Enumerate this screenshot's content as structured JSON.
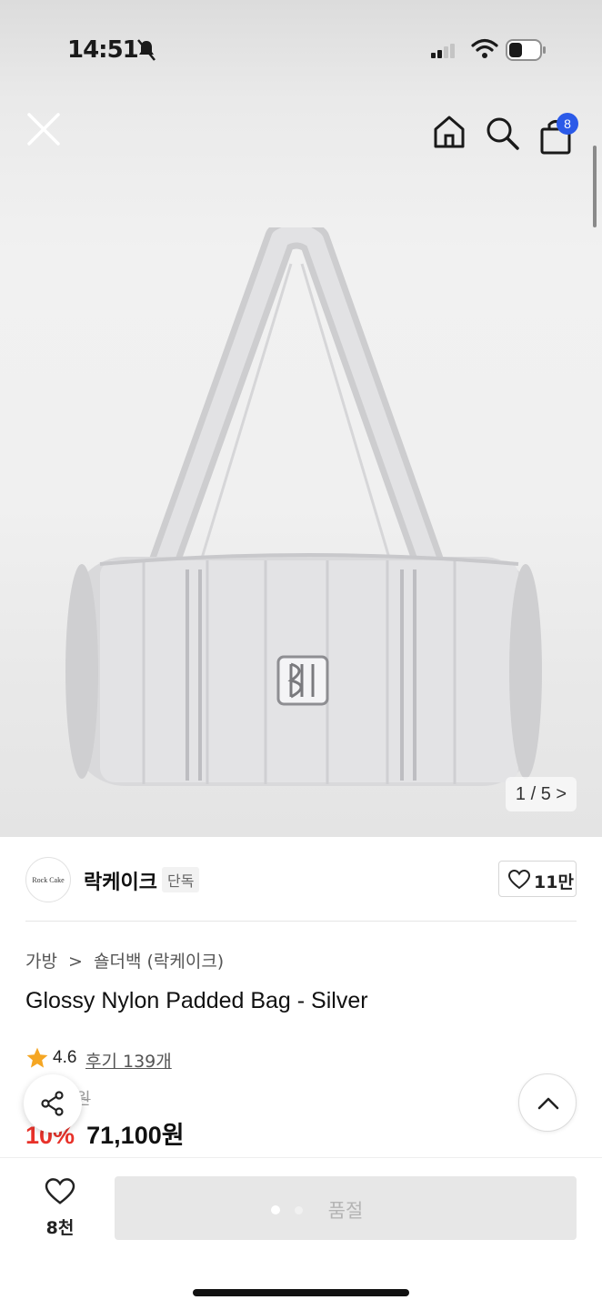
{
  "status_bar": {
    "time": "14:51"
  },
  "nav": {
    "cart_count": "8"
  },
  "gallery": {
    "pager": "1 / 5 >"
  },
  "brand": {
    "logo_text": "Rock Cake",
    "name": "락케이크",
    "tag": "단독",
    "likes": "11만"
  },
  "breadcrumb": [
    "가방",
    ">",
    "숄더백 (락케이크)"
  ],
  "product": {
    "title": "Glossy Nylon Padded Bag - Silver",
    "rating": "4.6",
    "reviews": "후기 139개",
    "original_price": "79,000원",
    "discount": "10%",
    "price": "71,100원"
  },
  "bottom": {
    "wish_count": "8천",
    "button_label": "품절"
  },
  "colors": {
    "accent_red": "#e8322a",
    "badge_blue": "#2b5ae8",
    "star": "#f5a623"
  }
}
